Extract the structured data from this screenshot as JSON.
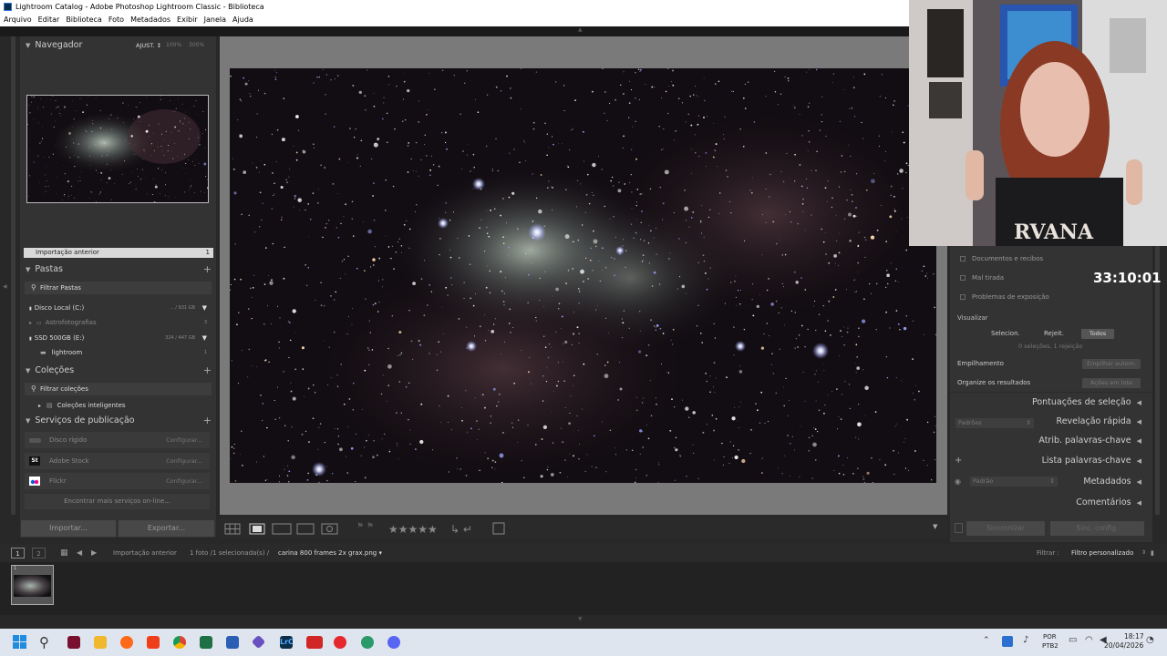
{
  "window": {
    "title": "Lightroom Catalog - Adobe Photoshop Lightroom Classic - Biblioteca"
  },
  "menu": [
    "Arquivo",
    "Editar",
    "Biblioteca",
    "Foto",
    "Metadados",
    "Exibir",
    "Janela",
    "Ajuda"
  ],
  "navigator": {
    "title": "Navegador",
    "fit": "AJUST. ↕",
    "zoom1": "100%",
    "zoom2": "300%"
  },
  "import_bar": {
    "label": "Importação anterior",
    "count": "1"
  },
  "folders": {
    "title": "Pastas",
    "filter": "Filtrar Pastas",
    "items": [
      {
        "name": "Disco Local (C:)",
        "size": "... / 931 GB"
      },
      {
        "name": "Astrofotografias",
        "count": "3"
      },
      {
        "name": "SSD 500GB (E:)",
        "size": "324 / 447 GB"
      },
      {
        "name": "lightroom",
        "count": "1"
      }
    ]
  },
  "collections": {
    "title": "Coleções",
    "filter": "Filtrar coleções",
    "smart": "Coleções inteligentes"
  },
  "publish": {
    "title": "Serviços de publicação",
    "items": [
      {
        "name": "Disco rígido",
        "action": "Configurar..."
      },
      {
        "name": "Adobe Stock",
        "action": "Configurar..."
      },
      {
        "name": "Flickr",
        "action": "Configurar..."
      }
    ],
    "find_more": "Encontrar mais serviços on-line..."
  },
  "buttons": {
    "import": "Importar...",
    "export": "Exportar...",
    "sync": "Sincronizar",
    "sync_settings": "Sinc. config."
  },
  "right": {
    "items": [
      "Documentos e recibos",
      "Mal tirada",
      "Problemas de exposição"
    ],
    "view_label": "Visualizar",
    "view_opts": [
      "Selecion.",
      "Rejeit.",
      "Todos"
    ],
    "view_status": "0 seleções, 1 rejeição",
    "stacking": "Empilhamento",
    "stacking_btn": "Empilhar autom.",
    "organize": "Organize os resultados",
    "organize_btn": "Ações em lote",
    "panels": [
      "Pontuações de seleção",
      "Revelação rápida",
      "Atrib. palavras-chave",
      "Lista palavras-chave",
      "Metadados",
      "Comentários"
    ],
    "preset": "Padrões",
    "meta_preset": "Padrão"
  },
  "timer": "33:10:01",
  "filmstrip": {
    "page1": "1",
    "page2": "2",
    "source": "Importação anterior",
    "info": "1 foto /1 selecionada(s) /",
    "file": "carina 800 frames 2x grax.png ▾",
    "filter_label": "Filtrar :",
    "filter_value": "Filtro personalizado",
    "thumb_index": "1"
  },
  "taskbar": {
    "lang1": "POR",
    "lang2": "PTB2",
    "time": "18:17",
    "date": "20/04/2026"
  },
  "colors": {
    "panel": "#333333",
    "accent": "#dddddd"
  }
}
